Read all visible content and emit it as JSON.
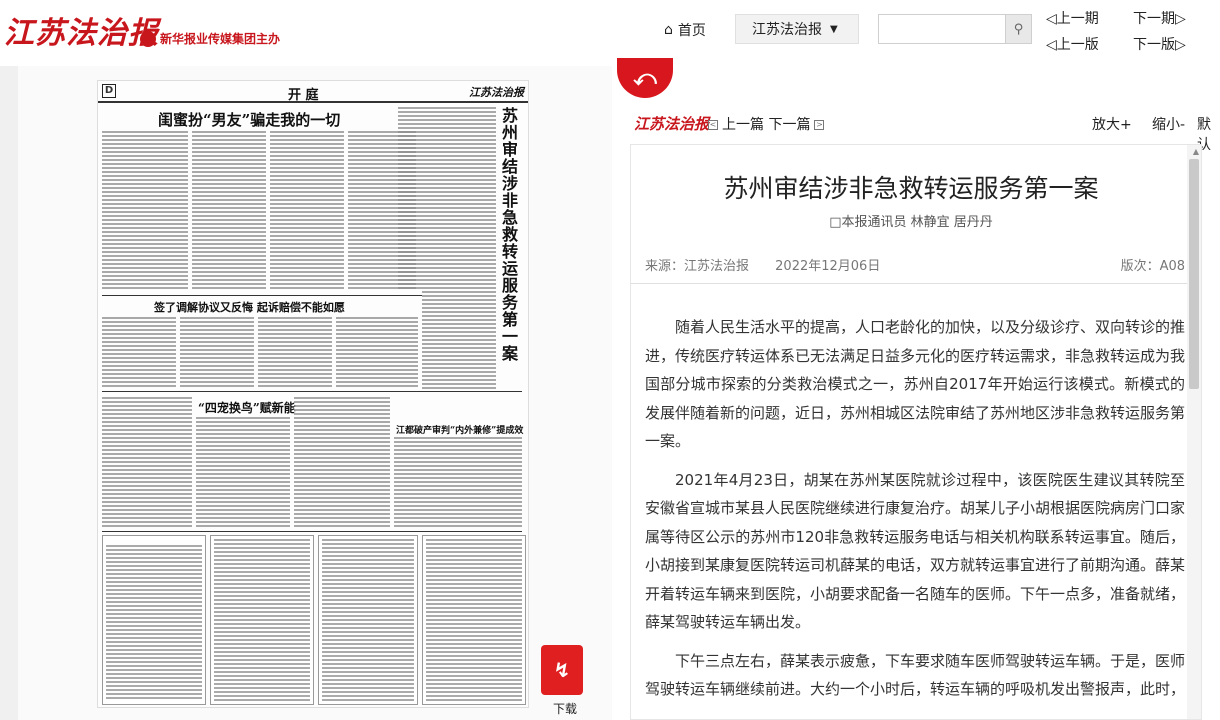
{
  "header": {
    "logo": "江苏法治报",
    "group": "新华报业传媒集团主办",
    "home_label": "首页",
    "paper_select": "江苏法治报",
    "search_value": "",
    "prev_issue": "上一期",
    "next_issue": "下一期",
    "prev_page": "上一版",
    "next_page": "下一版"
  },
  "newspaper": {
    "page_letter": "D",
    "section": "开 庭",
    "brand": "江苏法治报",
    "headline1": "闺蜜扮“男友”骗走我的一切",
    "headline2": "签了调解协议又反悔 起诉赔偿不能如愿",
    "headline3": "“四宠换鸟”赋新能",
    "headline4": "江都破产审判“内外兼修”提成效",
    "side_headline": "苏州审结涉非急救转运服务第一案",
    "download_label": "下载"
  },
  "article": {
    "brand": "江苏法治报",
    "prev_label": "上一篇",
    "next_label": "下一篇",
    "zoom_in": "放大+",
    "zoom_out": "缩小-",
    "default": "默认",
    "title": "苏州审结涉非急救转运服务第一案",
    "author": "□本报通讯员 林静宜 居丹丹",
    "source": "来源：江苏法治报",
    "date": "2022年12月06日",
    "page_no": "版次：A08",
    "paragraphs": [
      "随着人民生活水平的提高，人口老龄化的加快，以及分级诊疗、双向转诊的推进，传统医疗转运体系已无法满足日益多元化的医疗转运需求，非急救转运成为我国部分城市探索的分类救治模式之一，苏州自2017年开始运行该模式。新模式的发展伴随着新的问题，近日，苏州相城区法院审结了苏州地区涉非急救转运服务第一案。",
      "2021年4月23日，胡某在苏州某医院就诊过程中，该医院医生建议其转院至安徽省宣城市某县人民医院继续进行康复治疗。胡某儿子小胡根据医院病房门口家属等待区公示的苏州市120非急救转运服务电话与相关机构联系转运事宜。随后，小胡接到某康复医院转运司机薛某的电话，双方就转运事宜进行了前期沟通。薛某开着转运车辆来到医院，小胡要求配备一名随车的医师。下午一点多，准备就绪，薛某驾驶转运车辆出发。",
      "下午三点左右，薛某表示疲惫，下车要求随车医师驾驶转运车辆。于是，医师驾驶转运车辆继续前进。大约一个小时后，转运车辆的呼吸机发出警报声，此时，"
    ]
  },
  "colors": {
    "brand_red": "#c8161d",
    "background": "#f0f0f0"
  }
}
